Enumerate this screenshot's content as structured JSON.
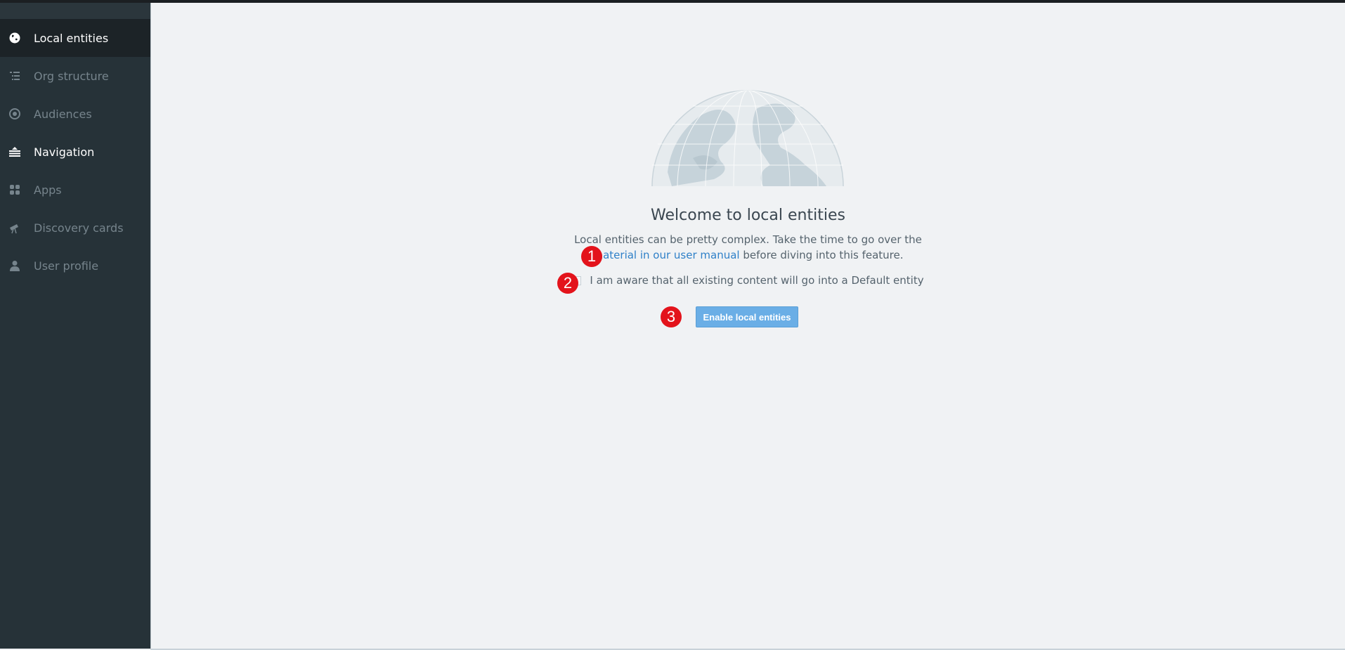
{
  "sidebar": {
    "items": [
      {
        "label": "Local entities",
        "icon": "globe-icon"
      },
      {
        "label": "Org structure",
        "icon": "org-tree-icon"
      },
      {
        "label": "Audiences",
        "icon": "target-icon"
      },
      {
        "label": "Navigation",
        "icon": "navigation-icon"
      },
      {
        "label": "Apps",
        "icon": "apps-grid-icon"
      },
      {
        "label": "Discovery cards",
        "icon": "telescope-icon"
      },
      {
        "label": "User profile",
        "icon": "user-icon"
      }
    ],
    "active_item": "Local entities"
  },
  "main": {
    "title": "Welcome to local entities",
    "description_line1": "Local entities can be pretty complex. Take the time to go over the",
    "link_text": "material in our user manual",
    "description_line2_suffix": " before diving into this feature.",
    "checkbox_label": "I am aware that all existing content will go into a Default entity",
    "checkbox_checked": false,
    "enable_button_label": "Enable local entities"
  },
  "annotations": {
    "marker_1": "1",
    "marker_2": "2",
    "marker_3": "3"
  },
  "colors": {
    "sidebar_bg": "#263238",
    "main_bg": "#f0f2f4",
    "link": "#2f80c8",
    "button": "#6aaee6",
    "marker": "#e3131b"
  }
}
